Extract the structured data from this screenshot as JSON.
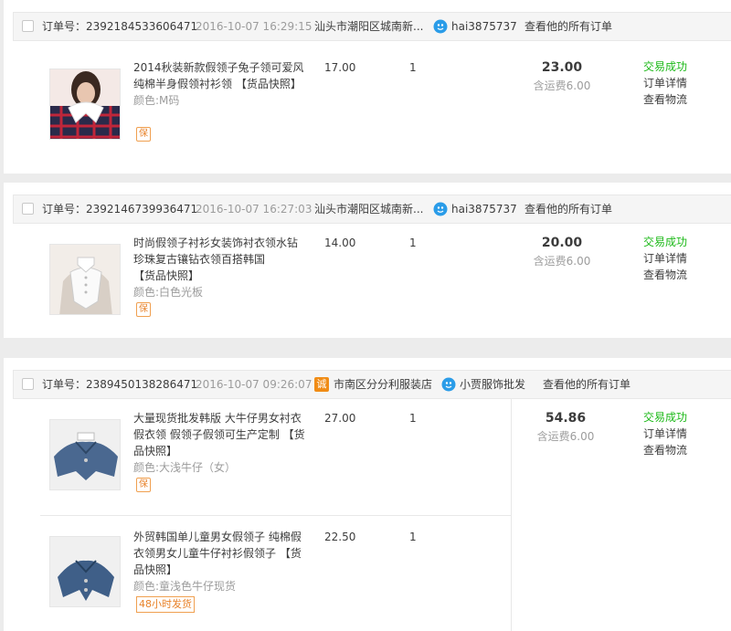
{
  "labels": {
    "order_no_prefix": "订单号：",
    "view_all_orders": "查看他的所有订单",
    "success": "交易成功",
    "order_detail": "订单详情",
    "view_logistics": "查看物流",
    "color_prefix": "颜色:",
    "snapshot": "【货品快照】",
    "bao_badge": "保",
    "shipping_prefix": "含运费",
    "ship_48h": "48小时发货"
  },
  "orders": [
    {
      "order_no": "2392184533606471",
      "date": "2016-10-07 16:29:15",
      "shop": "汕头市潮阳区城南新...",
      "seller": "hai3875737",
      "total": "23.00",
      "shipping": "6.00",
      "items": [
        {
          "title": "2014秋装新款假领子兔子领可爱风纯棉半身假领衬衫领",
          "color": "M码",
          "price": "17.00",
          "qty": "1"
        }
      ]
    },
    {
      "order_no": "2392146739936471",
      "date": "2016-10-07 16:27:03",
      "shop": "汕头市潮阳区城南新...",
      "seller": "hai3875737",
      "total": "20.00",
      "shipping": "6.00",
      "items": [
        {
          "title": "时尚假领子衬衫女装饰衬衣领水钻珍珠复古镶钻衣领百搭韩国",
          "color": "白色光板",
          "price": "14.00",
          "qty": "1"
        }
      ]
    },
    {
      "order_no": "2389450138286471",
      "date": "2016-10-07 09:26:07",
      "shop_badge": "诚",
      "shop": "市南区分分利服装店",
      "seller": "小贾服饰批发",
      "total": "54.86",
      "shipping": "6.00",
      "items": [
        {
          "title": "大量现货批发韩版 大牛仔男女衬衣假衣领 假领子假领可生产定制",
          "color": "大浅牛仔（女）",
          "price": "27.00",
          "qty": "1"
        },
        {
          "title": "外贸韩国单儿童男女假领子 纯棉假衣领男女儿童牛仔衬衫假领子",
          "color": "童浅色牛仔现货",
          "price": "22.50",
          "qty": "1"
        }
      ]
    }
  ]
}
